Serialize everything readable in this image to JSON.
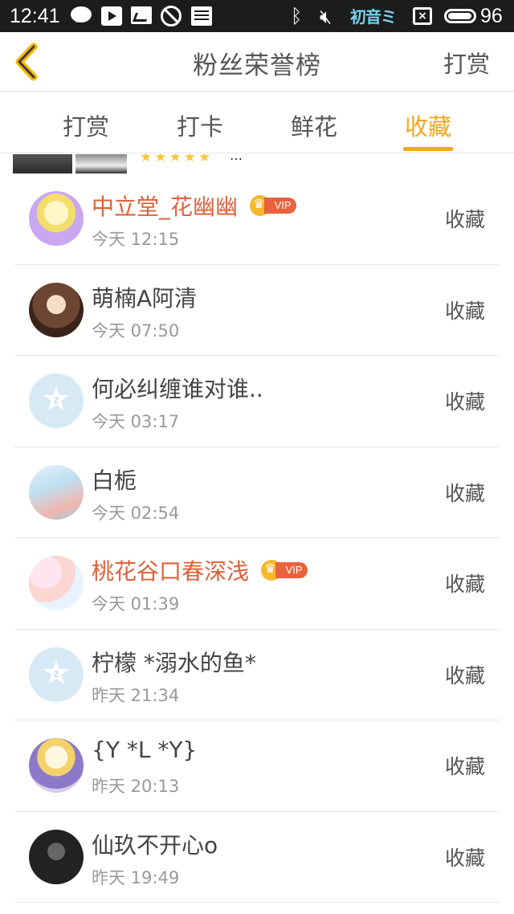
{
  "status_bar": {
    "time": "12:41",
    "brand_label": "初音ミク",
    "sim_label": "×",
    "battery_level": "96",
    "battery_fraction": 0.96,
    "icons": [
      "chat-icon",
      "video-play-icon",
      "picture-icon",
      "block-icon",
      "news-icon",
      "bluetooth-icon",
      "mute-icon",
      "brand-icon",
      "sim-icon",
      "battery-icon"
    ]
  },
  "header": {
    "title": "粉丝荣誉榜",
    "action": "打赏",
    "back_icon": "chevron-left-icon",
    "accent": "#f5a623"
  },
  "tabs": [
    {
      "label": "打赏",
      "active": false
    },
    {
      "label": "打卡",
      "active": false
    },
    {
      "label": "鲜花",
      "active": false
    },
    {
      "label": "收藏",
      "active": true
    }
  ],
  "partial_row": {
    "ellipsis": "…",
    "stars": "★★★★★"
  },
  "fans": [
    {
      "name": "中立堂_花幽幽",
      "time": "今天 12:15",
      "vip": true,
      "action": "收藏"
    },
    {
      "name": "萌楠A阿清",
      "time": "今天 07:50",
      "vip": false,
      "action": "收藏"
    },
    {
      "name": "何必纠缠谁对谁..",
      "time": "今天 03:17",
      "vip": false,
      "action": "收藏"
    },
    {
      "name": "白栀",
      "time": "今天 02:54",
      "vip": false,
      "action": "收藏"
    },
    {
      "name": "桃花谷口春深浅",
      "time": "今天 01:39",
      "vip": true,
      "action": "收藏"
    },
    {
      "name": "柠檬 *溺水的鱼*",
      "time": "昨天 21:34",
      "vip": false,
      "action": "收藏"
    },
    {
      "name": "{Y *L *Y}",
      "time": "昨天 20:13",
      "vip": false,
      "action": "收藏"
    },
    {
      "name": "仙玖不开心o",
      "time": "昨天 19:49",
      "vip": false,
      "action": "收藏"
    }
  ],
  "vip_label": "VIP",
  "colors": {
    "vip_name": "#e0603a",
    "vip_badge": "#e8623e",
    "crown": "#f7b82b",
    "muted_text": "#999999"
  }
}
